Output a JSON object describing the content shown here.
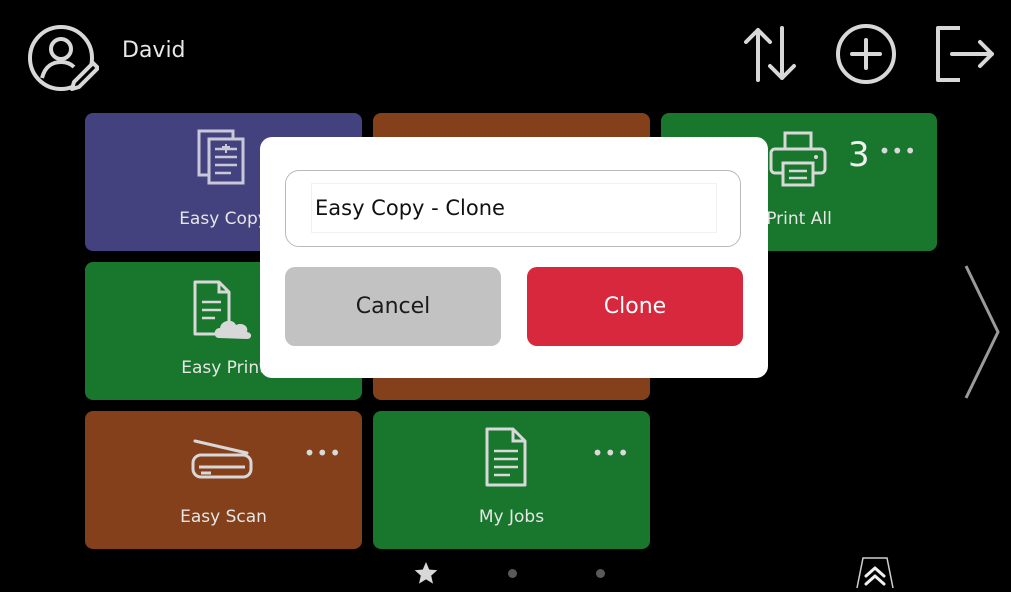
{
  "header": {
    "user_name": "David",
    "icons": [
      "avatar-edit-icon",
      "sort-arrows-icon",
      "add-circle-icon",
      "logout-icon"
    ]
  },
  "tiles": [
    {
      "label": "Easy Copy",
      "color": "#43427f",
      "icon": "copy-document-icon",
      "more": ""
    },
    {
      "label": "",
      "color": "#83401a",
      "icon": "",
      "more": ""
    },
    {
      "label": "Print All",
      "color": "#18772d",
      "icon": "printer-icon",
      "badge": "3",
      "more": "•••"
    },
    {
      "label": "Easy Print",
      "color": "#18772d",
      "icon": "cloud-document-icon",
      "more": ""
    },
    {
      "label": "",
      "color": "#83401a",
      "icon": "",
      "more": ""
    },
    {
      "label": "Easy Scan",
      "color": "#83401a",
      "icon": "scanner-icon",
      "more": "•••"
    },
    {
      "label": "My Jobs",
      "color": "#18772d",
      "icon": "document-list-icon",
      "more": "•••"
    }
  ],
  "navigation": {
    "next_icon": "chevron-right-icon",
    "pages": [
      "favorites-star",
      "page-2",
      "page-3"
    ],
    "expand_icon": "double-chevron-up-icon"
  },
  "dialog": {
    "name_value": "Easy Copy - Clone",
    "cancel_label": "Cancel",
    "clone_label": "Clone",
    "clone_color": "#d8283d"
  }
}
